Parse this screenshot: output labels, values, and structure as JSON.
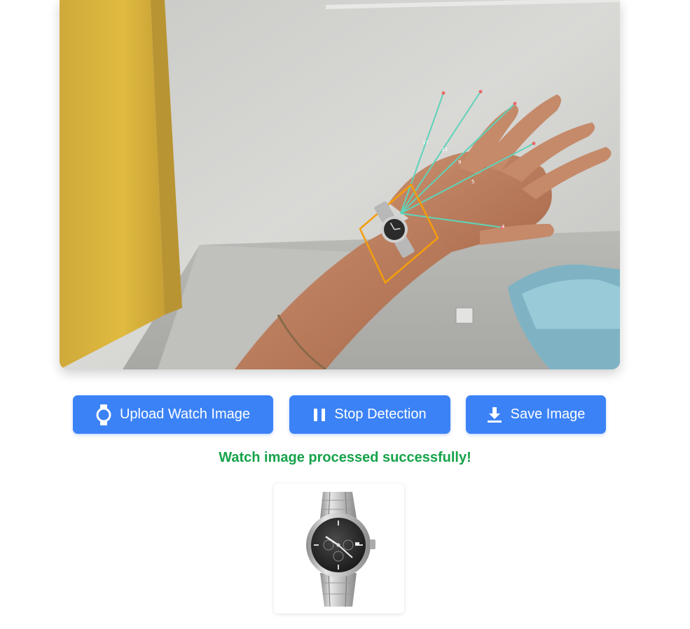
{
  "camera": {
    "landmark_labels": [
      "17",
      "13",
      "9",
      "5",
      "4"
    ],
    "overlay_color": "#f59e0b",
    "landmark_line_color": "#5fd3b8"
  },
  "controls": {
    "upload": {
      "label": "Upload Watch Image",
      "icon": "watch-icon"
    },
    "stop": {
      "label": "Stop Detection",
      "icon": "pause-icon"
    },
    "save": {
      "label": "Save Image",
      "icon": "download-icon"
    }
  },
  "status": {
    "message": "Watch image processed successfully!",
    "color": "#16a34a"
  },
  "theme": {
    "accent": "#3b82f6"
  }
}
